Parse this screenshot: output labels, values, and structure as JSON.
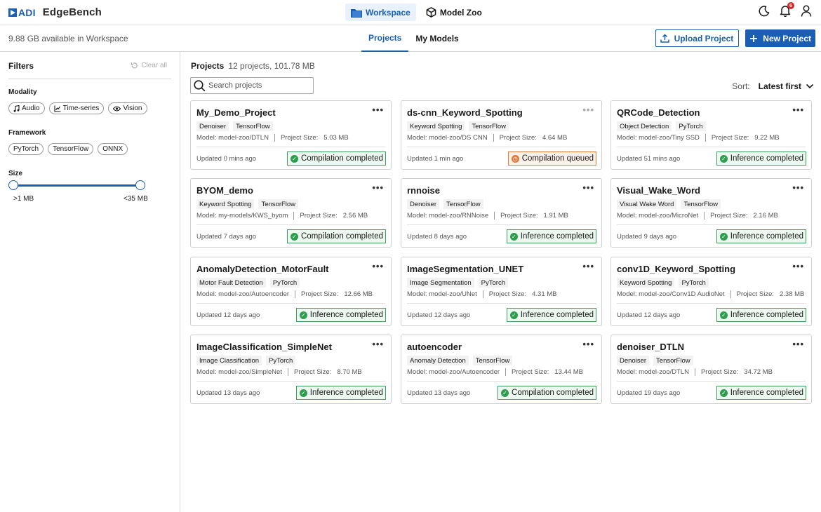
{
  "brand": {
    "logo_text": "ADI",
    "app_name": "EdgeBench"
  },
  "topnav": [
    {
      "label": "Workspace",
      "icon": "folder-icon",
      "active": true
    },
    {
      "label": "Model Zoo",
      "icon": "cube-icon",
      "active": false
    }
  ],
  "top_icons": {
    "notifications_count": "6"
  },
  "subbar": {
    "storage": "9.88 GB available in Workspace",
    "tabs": [
      {
        "label": "Projects",
        "active": true
      },
      {
        "label": "My Models",
        "active": false
      }
    ],
    "upload_label": "Upload Project",
    "new_label": "New Project"
  },
  "filters": {
    "title": "Filters",
    "clear_all": "Clear all",
    "modality_label": "Modality",
    "modality": [
      {
        "label": "Audio",
        "icon": "music-note-icon"
      },
      {
        "label": "Time-series",
        "icon": "chart-icon"
      },
      {
        "label": "Vision",
        "icon": "eye-icon"
      }
    ],
    "framework_label": "Framework",
    "framework": [
      "PyTorch",
      "TensorFlow",
      "ONNX"
    ],
    "size_label": "Size",
    "size_min": ">1 MB",
    "size_max": "<35 MB"
  },
  "main": {
    "title": "Projects",
    "count": "12 projects, 101.78 MB",
    "search_placeholder": "Search projects",
    "sort_label": "Sort:",
    "sort_value": "Latest first"
  },
  "size_label": "Project Size:",
  "projects": [
    {
      "name": "My_Demo_Project",
      "task": "Denoiser",
      "framework": "TensorFlow",
      "model": "Model: model-zoo/DTLN",
      "size": "5.03 MB",
      "updated_prefix": "Updated",
      "updated": "0 mins ago",
      "status": "Compilation completed",
      "state": "done",
      "menu_muted": false
    },
    {
      "name": "ds-cnn_Keyword_Spotting",
      "task": "Keyword Spotting",
      "framework": "TensorFlow",
      "model": "Model: model-zoo/DS CNN",
      "size": "4.64 MB",
      "updated_prefix": "Updated",
      "updated": "1 min ago",
      "status": "Compilation queued",
      "state": "queued",
      "menu_muted": true
    },
    {
      "name": "QRCode_Detection",
      "task": "Object Detection",
      "framework": "PyTorch",
      "model": "Model: model-zoo/Tiny SSD",
      "size": "9.22 MB",
      "updated_prefix": "Updated",
      "updated": "51 mins ago",
      "status": "Inference completed",
      "state": "done",
      "menu_muted": false
    },
    {
      "name": "BYOM_demo",
      "task": "Keyword Spotting",
      "framework": "TensorFlow",
      "model": "Model: my-models/KWS_byom",
      "size": "2.56 MB",
      "updated_prefix": "Updated",
      "updated": "7 days ago",
      "status": "Compilation completed",
      "state": "done",
      "menu_muted": false
    },
    {
      "name": "rnnoise",
      "task": "Denoiser",
      "framework": "TensorFlow",
      "model": "Model: model-zoo/RNNoise",
      "size": "1.91 MB",
      "updated_prefix": "Updated",
      "updated": "8 days ago",
      "status": "Inference completed",
      "state": "done",
      "menu_muted": false
    },
    {
      "name": "Visual_Wake_Word",
      "task": "Visual Wake Word",
      "framework": "TensorFlow",
      "model": "Model: model-zoo/MicroNet",
      "size": "2.16 MB",
      "updated_prefix": "Updated",
      "updated": "9 days ago",
      "status": "Inference completed",
      "state": "done",
      "menu_muted": false
    },
    {
      "name": "AnomalyDetection_MotorFault",
      "task": "Motor Fault Detection",
      "framework": "PyTorch",
      "model": "Model: model-zoo/Autoencoder",
      "size": "12.66 MB",
      "updated_prefix": "Updated",
      "updated": "12 days ago",
      "status": "Inference completed",
      "state": "done",
      "menu_muted": false
    },
    {
      "name": "ImageSegmentation_UNET",
      "task": "Image Segmentation",
      "framework": "PyTorch",
      "model": "Model: model-zoo/UNet",
      "size": "4.31 MB",
      "updated_prefix": "Updated",
      "updated": "12 days ago",
      "status": "Inference completed",
      "state": "done",
      "menu_muted": false
    },
    {
      "name": "conv1D_Keyword_Spotting",
      "task": "Keyword Spotting",
      "framework": "PyTorch",
      "model": "Model: model-zoo/Conv1D AudioNet",
      "size": "2.38 MB",
      "updated_prefix": "Updated",
      "updated": "12 days ago",
      "status": "Inference completed",
      "state": "done",
      "menu_muted": false
    },
    {
      "name": "ImageClassification_SimpleNet",
      "task": "Image Classification",
      "framework": "PyTorch",
      "model": "Model: model-zoo/SimpleNet",
      "size": "8.70 MB",
      "updated_prefix": "Updated",
      "updated": "13 days ago",
      "status": "Inference completed",
      "state": "done",
      "menu_muted": false
    },
    {
      "name": "autoencoder",
      "task": "Anomaly Detection",
      "framework": "TensorFlow",
      "model": "Model: model-zoo/Autoencoder",
      "size": "13.44 MB",
      "updated_prefix": "Updated",
      "updated": "13 days ago",
      "status": "Compilation completed",
      "state": "done",
      "menu_muted": false
    },
    {
      "name": "denoiser_DTLN",
      "task": "Denoiser",
      "framework": "TensorFlow",
      "model": "Model: model-zoo/DTLN",
      "size": "34.72 MB",
      "updated_prefix": "Updated",
      "updated": "19 days ago",
      "status": "Inference completed",
      "state": "done",
      "menu_muted": false
    }
  ],
  "colors": {
    "accent": "#1a5fb4",
    "success": "#2e9e4e",
    "warning": "#e07a3c"
  }
}
